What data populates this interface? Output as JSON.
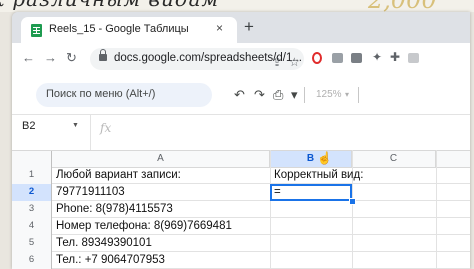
{
  "overlay": {
    "handwriting_left": "к различным видам",
    "handwriting_right": "2,000"
  },
  "browser": {
    "tab_title": "Reels_15 - Google Таблицы",
    "tab_close": "×",
    "new_tab": "+",
    "address": {
      "back": "←",
      "forward": "→",
      "reload": "↻",
      "url": "docs.google.com/spreadsheets/d/1...",
      "share": "⇪",
      "bookmark": "☆"
    },
    "extensions": {
      "pin": "✦",
      "puzzle": "✚"
    }
  },
  "toolbar": {
    "menu_search_placeholder": "Поиск по меню (Alt+/)",
    "undo": "↶",
    "redo": "↷",
    "print": "⎙",
    "paint_format": "▾",
    "zoom": "125%",
    "zoom_caret": "▾"
  },
  "formula_bar": {
    "name_box": "B2",
    "name_caret": "▼",
    "fx": "fx",
    "content": ""
  },
  "grid": {
    "columns": [
      "A",
      "B",
      "C"
    ],
    "selected_column": "B",
    "selected_row": "2",
    "rows": [
      {
        "num": "1",
        "a": "Любой вариант записи:",
        "b": "Корректный вид:"
      },
      {
        "num": "2",
        "a": "79771911103",
        "b": "="
      },
      {
        "num": "3",
        "a": "Phone: 8(978)4115573",
        "b": ""
      },
      {
        "num": "4",
        "a": "Номер телефона: 8(969)7669481",
        "b": ""
      },
      {
        "num": "5",
        "a": "Тел. 89349390101",
        "b": ""
      },
      {
        "num": "6",
        "a": "Тел.: +7 9064707953",
        "b": ""
      },
      {
        "num": "7",
        "a": "",
        "b": ""
      }
    ]
  }
}
